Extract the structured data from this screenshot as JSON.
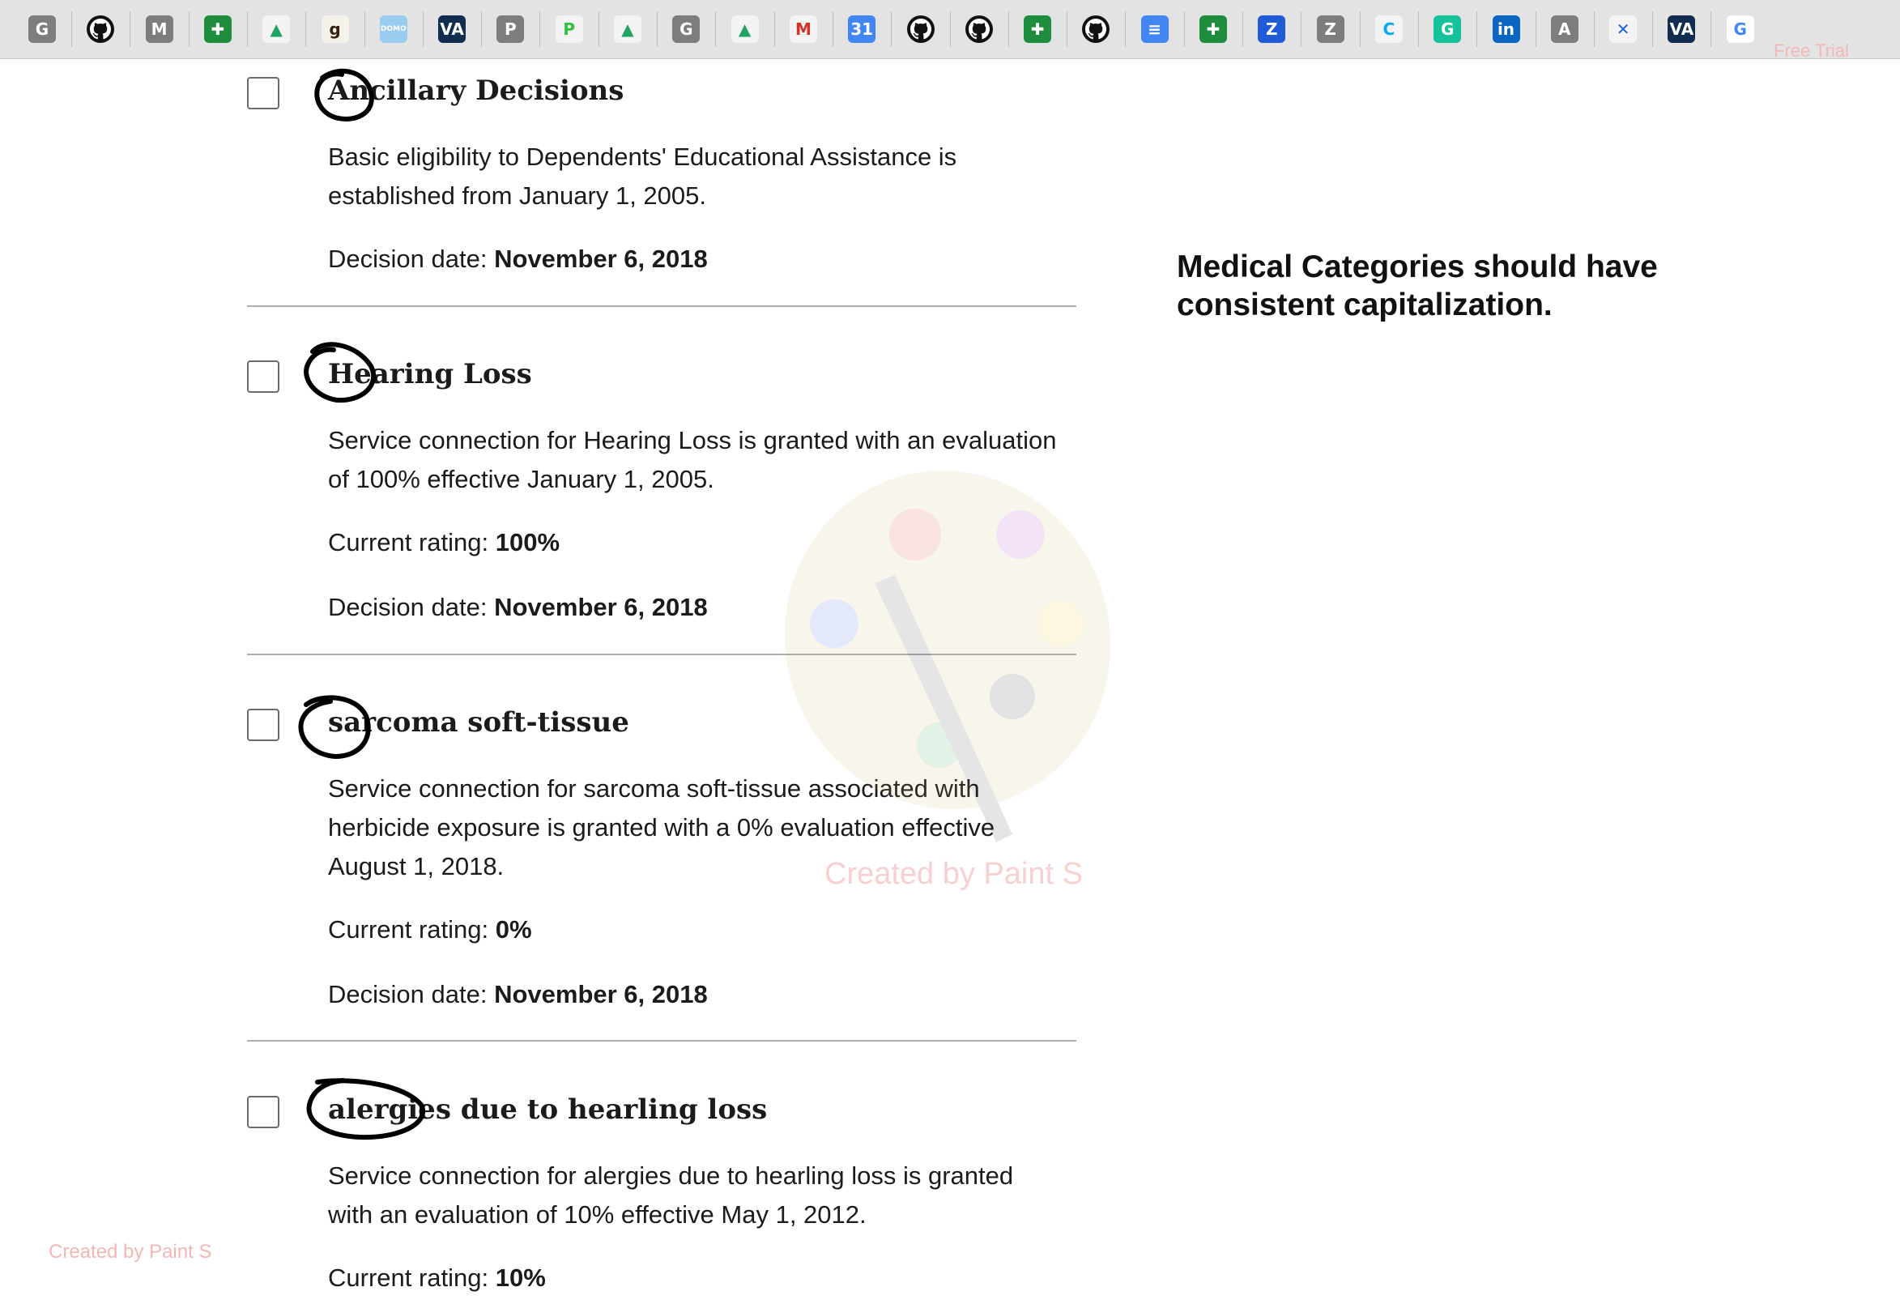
{
  "bookmarks": [
    {
      "icon": "g-gray-icon",
      "glyph": "G",
      "bg": "#7d7d7d",
      "fg": "#ffffff"
    },
    {
      "icon": "github-icon",
      "glyph": "",
      "bg": "#111111",
      "fg": "#ffffff"
    },
    {
      "icon": "m-gray-icon",
      "glyph": "M",
      "bg": "#7d7d7d",
      "fg": "#ffffff"
    },
    {
      "icon": "google-sheets-icon",
      "glyph": "✚",
      "bg": "#1e8e3e",
      "fg": "#ffffff"
    },
    {
      "icon": "google-drive-icon",
      "glyph": "▲",
      "bg": "#f3f3f3",
      "fg": "#1fa463"
    },
    {
      "icon": "goodreads-icon",
      "glyph": "g",
      "bg": "#f4f1ea",
      "fg": "#382110"
    },
    {
      "icon": "domo-icon",
      "glyph": "DOMO",
      "bg": "#99ccee",
      "fg": "#ffffff"
    },
    {
      "icon": "va-icon",
      "glyph": "VA",
      "bg": "#112e51",
      "fg": "#ffffff"
    },
    {
      "icon": "p-gray-icon",
      "glyph": "P",
      "bg": "#7d7d7d",
      "fg": "#ffffff"
    },
    {
      "icon": "pivotal-icon",
      "glyph": "P",
      "bg": "#f3f3f3",
      "fg": "#2fbf3a"
    },
    {
      "icon": "google-drive-icon",
      "glyph": "▲",
      "bg": "#f3f3f3",
      "fg": "#1fa463"
    },
    {
      "icon": "g-gray-icon",
      "glyph": "G",
      "bg": "#7d7d7d",
      "fg": "#ffffff"
    },
    {
      "icon": "google-drive-icon",
      "glyph": "▲",
      "bg": "#f3f3f3",
      "fg": "#1fa463"
    },
    {
      "icon": "gmail-icon",
      "glyph": "M",
      "bg": "#f3f3f3",
      "fg": "#d93025"
    },
    {
      "icon": "google-calendar-icon",
      "glyph": "31",
      "bg": "#4285f4",
      "fg": "#ffffff"
    },
    {
      "icon": "github-icon",
      "glyph": "",
      "bg": "#111111",
      "fg": "#ffffff"
    },
    {
      "icon": "github-icon",
      "glyph": "",
      "bg": "#111111",
      "fg": "#ffffff"
    },
    {
      "icon": "google-sheets-icon",
      "glyph": "✚",
      "bg": "#1e8e3e",
      "fg": "#ffffff"
    },
    {
      "icon": "github-icon",
      "glyph": "",
      "bg": "#111111",
      "fg": "#ffffff"
    },
    {
      "icon": "google-docs-icon",
      "glyph": "≡",
      "bg": "#4285f4",
      "fg": "#ffffff"
    },
    {
      "icon": "google-sheets-icon",
      "glyph": "✚",
      "bg": "#1e8e3e",
      "fg": "#ffffff"
    },
    {
      "icon": "zendesk-blue-icon",
      "glyph": "Z",
      "bg": "#1f5bd6",
      "fg": "#ffffff"
    },
    {
      "icon": "z-gray-icon",
      "glyph": "Z",
      "bg": "#7d7d7d",
      "fg": "#ffffff"
    },
    {
      "icon": "clockify-icon",
      "glyph": "C",
      "bg": "#f3f3f3",
      "fg": "#03a9f4"
    },
    {
      "icon": "grammarly-icon",
      "glyph": "G",
      "bg": "#15c39a",
      "fg": "#ffffff"
    },
    {
      "icon": "linkedin-icon",
      "glyph": "in",
      "bg": "#0a66c2",
      "fg": "#ffffff"
    },
    {
      "icon": "a-gray-icon",
      "glyph": "A",
      "bg": "#7d7d7d",
      "fg": "#ffffff"
    },
    {
      "icon": "confluence-icon",
      "glyph": "✕",
      "bg": "#f3f3f3",
      "fg": "#1868db"
    },
    {
      "icon": "va-icon",
      "glyph": "VA",
      "bg": "#112e51",
      "fg": "#ffffff"
    },
    {
      "icon": "google-icon",
      "glyph": "G",
      "bg": "#ffffff",
      "fg": "#4285f4"
    }
  ],
  "free_trial": "Free Trial",
  "decisions": [
    {
      "title": "Ancillary Decisions",
      "description": "Basic eligibility to Dependents' Educational Assistance is established from January 1, 2005.",
      "rating_label": "",
      "rating": "",
      "date_label": "Decision date:",
      "date": "November 6, 2018"
    },
    {
      "title": "Hearing Loss",
      "description": "Service connection for Hearing Loss is granted with an evaluation of 100% effective January 1, 2005.",
      "rating_label": "Current rating:",
      "rating": "100%",
      "date_label": "Decision date:",
      "date": "November 6, 2018"
    },
    {
      "title": "sarcoma soft-tissue",
      "description": "Service connection for sarcoma soft-tissue associated with herbicide exposure is granted with a 0% evaluation effective August 1, 2018.",
      "rating_label": "Current rating:",
      "rating": "0%",
      "date_label": "Decision date:",
      "date": "November 6, 2018"
    },
    {
      "title": "alergies due to hearling loss",
      "description": "Service connection for alergies due to hearling loss is granted with an evaluation of 10% effective May 1, 2012.",
      "rating_label": "Current rating:",
      "rating": "10%",
      "date_label": "",
      "date": ""
    }
  ],
  "annotation_note": "Medical Categories should have consistent capitalization.",
  "watermark_main": "Created by Paint S",
  "watermark_corner": "Created by Paint S"
}
